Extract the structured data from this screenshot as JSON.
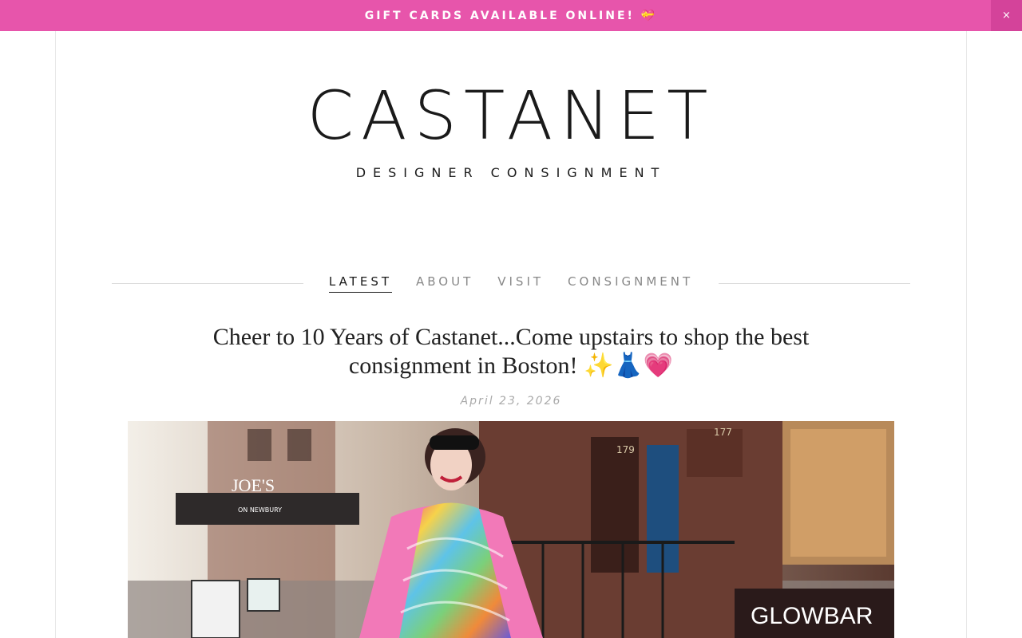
{
  "announcement": {
    "text": "GIFT CARDS AVAILABLE ONLINE! 💝",
    "close_label": "×"
  },
  "logo": {
    "name": "CASTANET",
    "tagline": "DESIGNER CONSIGNMENT"
  },
  "nav": {
    "items": [
      {
        "label": "LATEST",
        "active": true
      },
      {
        "label": "ABOUT",
        "active": false
      },
      {
        "label": "VISIT",
        "active": false
      },
      {
        "label": "CONSIGNMENT",
        "active": false
      }
    ]
  },
  "post": {
    "title": "Cheer to 10 Years of Castanet...Come upstairs to shop the best consignment in Boston! ✨👗💗",
    "date": "April 23, 2026"
  },
  "hero_image": {
    "signs": [
      "JOE'S",
      "ON NEWBURY",
      "179",
      "177",
      "GLOWBAR"
    ]
  },
  "colors": {
    "accent_pink": "#e755ab",
    "close_pink": "#d4439a"
  }
}
